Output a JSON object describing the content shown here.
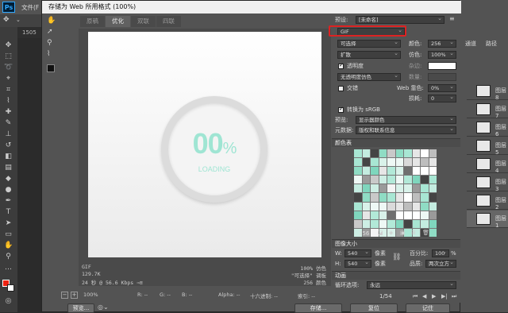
{
  "app": {
    "menu": [
      "文件(F"
    ]
  },
  "doc_tab": "1505",
  "dialog": {
    "title": "存储为 Web 所用格式 (100%)",
    "tabs": [
      "原稿",
      "优化",
      "双联",
      "四联"
    ],
    "canvas": {
      "percent_number": "00",
      "percent_sign": "%",
      "loading_text": "LOADING"
    },
    "info_left": [
      "GIF",
      "129.7K",
      "24 秒 @ 56.6 Kbps ⇒≡"
    ],
    "info_right": [
      "100% 仿色",
      "\"可选择\" 调板",
      "256 颜色"
    ],
    "status": {
      "zoom": "100%",
      "r": "R: --",
      "g": "G: --",
      "b": "B: --",
      "alpha": "Alpha: --",
      "hex": "十六进制: --",
      "index": "索引: --"
    },
    "buttons": {
      "preview": "预览...",
      "save": "存储...",
      "reset": "复位",
      "remember": "记住"
    }
  },
  "settings": {
    "preset_label": "预设:",
    "preset_value": "[未命名]",
    "format": "GIF",
    "reduction": "可选择",
    "colors_label": "颜色:",
    "colors_value": "256",
    "dither_algo": "扩散",
    "dither_label": "仿色:",
    "dither_value": "100%",
    "transparency_label": "透明度",
    "transparency_checked": true,
    "matte_label": "杂边:",
    "trans_dither": "无透明度仿色",
    "amount_label": "数量:",
    "interlaced_label": "交错",
    "interlaced_checked": false,
    "websnap_label": "Web 靠色:",
    "websnap_value": "0%",
    "lossy_label": "损耗:",
    "lossy_value": "0",
    "srgb_label": "转换为 sRGB",
    "srgb_checked": true,
    "preview_label": "预览:",
    "preview_value": "显示器颜色",
    "metadata_label": "元数据:",
    "metadata_value": "版权和联系信息",
    "color_table_label": "颜色表",
    "color_count": "256",
    "image_size_label": "图像大小",
    "w_label": "W:",
    "w_value": "540",
    "h_label": "H:",
    "h_value": "540",
    "px_unit": "像素",
    "percent_label": "百分比:",
    "percent_value": "100",
    "percent_unit": "%",
    "quality_label": "品质:",
    "quality_value": "两次立方",
    "animation_label": "动画",
    "loop_label": "循环选项:",
    "loop_value": "永远",
    "frame_counter": "1/54"
  },
  "layers": {
    "items": [
      "图层 8",
      "图层 7",
      "图层 6",
      "图层 5",
      "图层 4",
      "图层 3",
      "图层 2",
      "图层 1"
    ]
  },
  "right_tabs": [
    "通道",
    "路径"
  ],
  "colors": {
    "accent_teal": "#9fe5d3",
    "redbox": "#d22222"
  }
}
